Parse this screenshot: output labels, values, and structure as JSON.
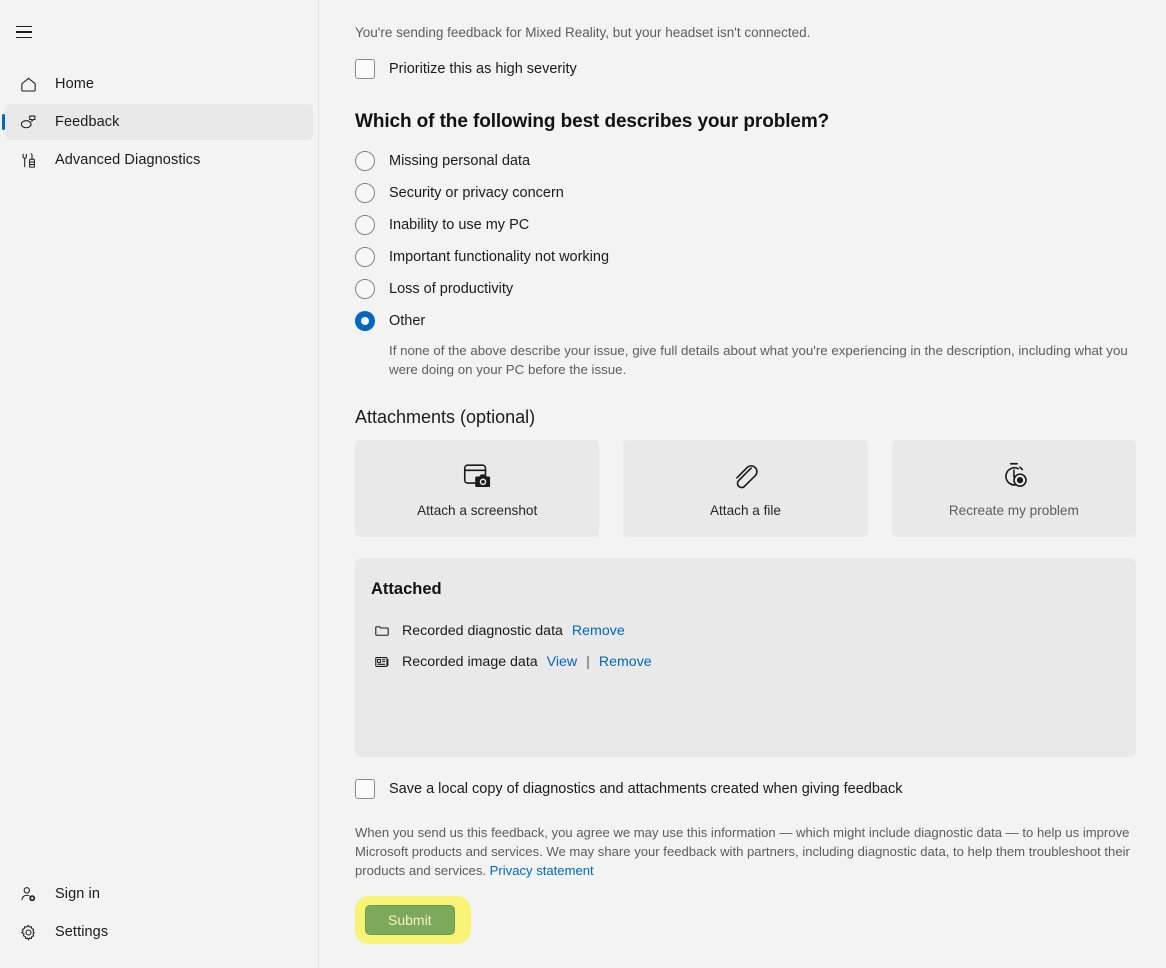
{
  "sidebar": {
    "menu_button": "menu-hamburger",
    "top_items": [
      {
        "label": "Home",
        "icon": "home-icon",
        "selected": false
      },
      {
        "label": "Feedback",
        "icon": "feedback-icon",
        "selected": true
      },
      {
        "label": "Advanced Diagnostics",
        "icon": "diagnostics-icon",
        "selected": false
      }
    ],
    "bottom_items": [
      {
        "label": "Sign in",
        "icon": "add-user-icon"
      },
      {
        "label": "Settings",
        "icon": "gear-icon"
      }
    ]
  },
  "main": {
    "notice": "You're sending feedback for Mixed Reality, but your headset isn't connected.",
    "priority_checkbox": {
      "label": "Prioritize this as high severity",
      "checked": false
    },
    "problem_question": "Which of the following best describes your problem?",
    "problem_options": [
      {
        "label": "Missing personal data",
        "selected": false
      },
      {
        "label": "Security or privacy concern",
        "selected": false
      },
      {
        "label": "Inability to use my PC",
        "selected": false
      },
      {
        "label": "Important functionality not working",
        "selected": false
      },
      {
        "label": "Loss of productivity",
        "selected": false
      },
      {
        "label": "Other",
        "selected": true
      }
    ],
    "other_help_text": "If none of the above describe your issue, give full details about what you're experiencing in the description, including what you were doing on your PC before the issue.",
    "attachments_heading": "Attachments (optional)",
    "attachment_cards": [
      {
        "label": "Attach a screenshot",
        "icon": "screenshot-icon"
      },
      {
        "label": "Attach a file",
        "icon": "paperclip-icon"
      },
      {
        "label": "Recreate my problem",
        "icon": "stopwatch-record-icon"
      }
    ],
    "attached": {
      "title": "Attached",
      "rows": [
        {
          "icon": "folder-icon",
          "name": "Recorded diagnostic data",
          "view": null,
          "remove": "Remove"
        },
        {
          "icon": "image-card-icon",
          "name": "Recorded image data",
          "view": "View",
          "separator": "|",
          "remove": "Remove"
        }
      ]
    },
    "save_local_checkbox": {
      "label": "Save a local copy of diagnostics and attachments created when giving feedback",
      "checked": false
    },
    "legal_text": "When you send us this feedback, you agree we may use this information — which might include diagnostic data — to help us improve Microsoft products and services. We may share your feedback with partners, including diagnostic data, to help them troubleshoot their products and services. ",
    "privacy_link": "Privacy statement",
    "submit_label": "Submit"
  },
  "colors": {
    "accent": "#0067c0",
    "link": "#0067c0",
    "page_bg": "#f3f3f3",
    "panel_bg": "#e9e9e9",
    "submit_bg": "#7ca95c",
    "submit_highlight": "#f8f374"
  }
}
